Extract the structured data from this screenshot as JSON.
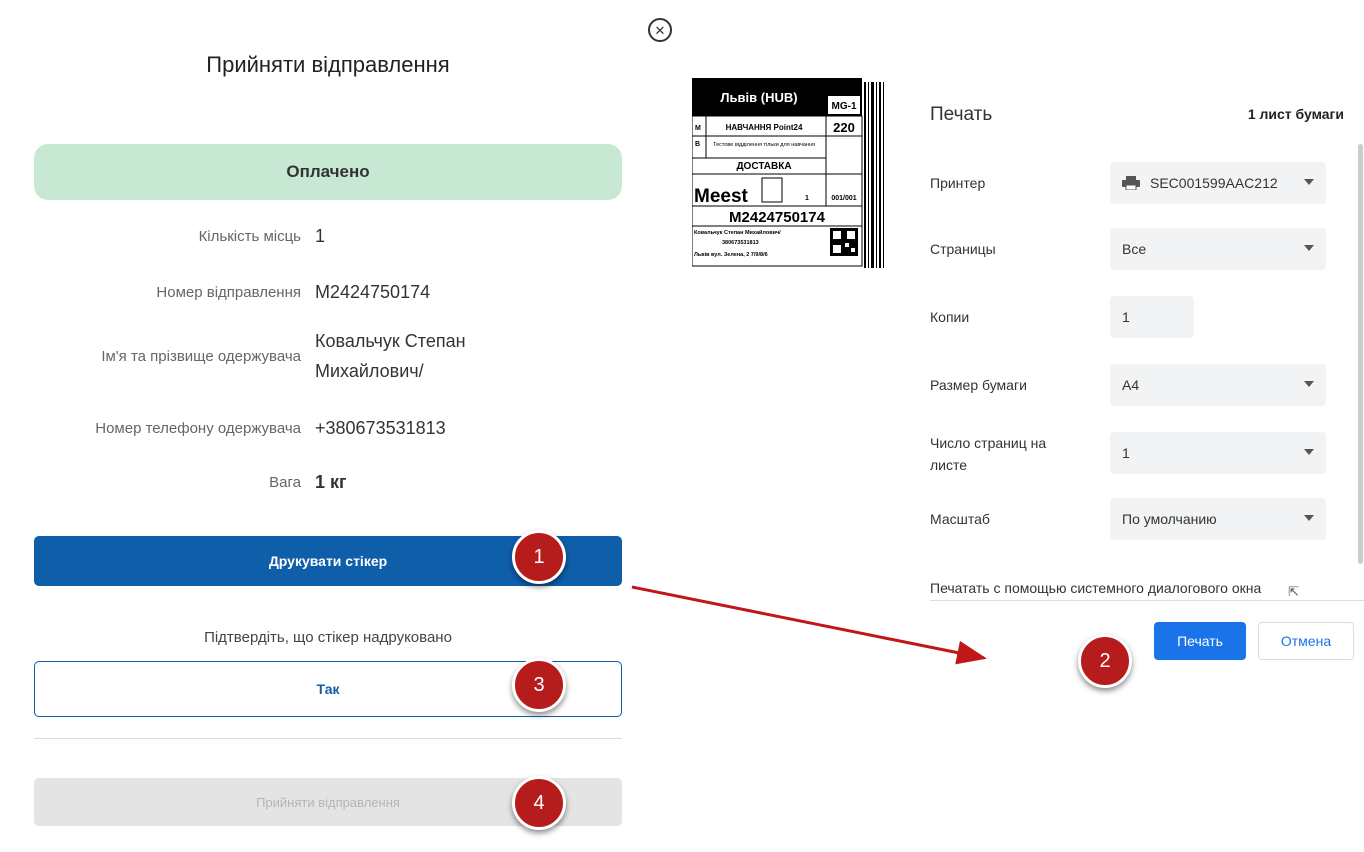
{
  "accept_panel": {
    "title": "Прийняти відправлення",
    "status": "Оплачено",
    "fields": [
      {
        "label": "Кількість місць",
        "value": "1"
      },
      {
        "label": "Номер відправлення",
        "value": "M2424750174"
      },
      {
        "label": "Ім'я та прізвище одержувача",
        "value": "Ковальчук Степан Михайлович/"
      },
      {
        "label": "Номер телефону одержувача",
        "value": "+380673531813"
      },
      {
        "label": "Вага",
        "value": "1 кг"
      }
    ],
    "print_sticker_button": "Друкувати стікер",
    "confirm_text": "Підтвердіть, що стікер надруковано",
    "yes_button": "Так",
    "accept_button": "Прийняти відправлення"
  },
  "steps": [
    "1",
    "2",
    "3",
    "4"
  ],
  "sticker": {
    "city": "Львів (HUB)",
    "code": "MG-1",
    "route": "220",
    "branch": "НАВЧАННЯ Point24",
    "branch_note": "Тестове відділення тільки для навчання",
    "delivery": "ДОСТАВКА",
    "brand": "Meest",
    "places": "1",
    "piece": "001/001",
    "tracking": "M2424750174",
    "recipient": "Ковальчук Степан Михайлович/",
    "phone": "380673531813",
    "address": "Львів вул. Зелена, 2 7/9/8/6",
    "row_m": "M",
    "row_b": "B"
  },
  "print_dialog": {
    "title": "Печать",
    "sheets": "1 лист бумаги",
    "printer_label": "Принтер",
    "printer_value": "SEC001599AAC212",
    "pages_label": "Страницы",
    "pages_value": "Все",
    "copies_label": "Копии",
    "copies_value": "1",
    "paper_label": "Размер бумаги",
    "paper_value": "A4",
    "per_sheet_label": "Число страниц на листе",
    "per_sheet_value": "1",
    "scale_label": "Масштаб",
    "scale_value": "По умолчанию",
    "system_dialog": "Печатать с помощью системного диалогового окна",
    "print_button": "Печать",
    "cancel_button": "Отмена"
  },
  "colors": {
    "primary": "#0f5eaa",
    "paid_bg": "#c7e8d3",
    "badge": "#b61c1c",
    "chrome_blue": "#1a73e8"
  }
}
